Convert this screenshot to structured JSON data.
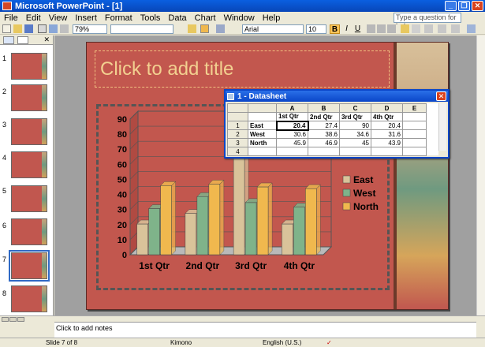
{
  "window": {
    "title": "Microsoft PowerPoint - [1]"
  },
  "menu": [
    "File",
    "Edit",
    "View",
    "Insert",
    "Format",
    "Tools",
    "Data",
    "Chart",
    "Window",
    "Help"
  ],
  "help_box": "Type a question for help",
  "toolbar": {
    "zoom": "79%",
    "font": "Arial",
    "font_size": "10",
    "bold": "B",
    "italic": "I",
    "underline": "U"
  },
  "thumbnails": [
    "1",
    "2",
    "3",
    "4",
    "5",
    "6",
    "7",
    "8"
  ],
  "slide": {
    "title_placeholder": "Click to add title"
  },
  "notes_placeholder": "Click to add notes",
  "statusbar": {
    "slide": "Slide 7 of 8",
    "design": "Kimono",
    "language": "English (U.S.)"
  },
  "datasheet": {
    "title": "1 - Datasheet",
    "col_letters": [
      "A",
      "B",
      "C",
      "D",
      "E"
    ],
    "col_headers": [
      "1st Qtr",
      "2nd Qtr",
      "3rd Qtr",
      "4th Qtr"
    ],
    "rows": [
      {
        "num": "1",
        "label": "East",
        "values": [
          "20.4",
          "27.4",
          "90",
          "20.4"
        ]
      },
      {
        "num": "2",
        "label": "West",
        "values": [
          "30.6",
          "38.6",
          "34.6",
          "31.6"
        ]
      },
      {
        "num": "3",
        "label": "North",
        "values": [
          "45.9",
          "46.9",
          "45",
          "43.9"
        ]
      },
      {
        "num": "4",
        "label": "",
        "values": [
          "",
          "",
          "",
          ""
        ]
      }
    ]
  },
  "colors": {
    "east": "#d9c39a",
    "west": "#7fb38a",
    "north": "#f0b84e",
    "slide_bg": "#c2574e"
  },
  "chart_data": {
    "type": "bar",
    "categories": [
      "1st Qtr",
      "2nd Qtr",
      "3rd Qtr",
      "4th Qtr"
    ],
    "series": [
      {
        "name": "East",
        "values": [
          20.4,
          27.4,
          90,
          20.4
        ]
      },
      {
        "name": "West",
        "values": [
          30.6,
          38.6,
          34.6,
          31.6
        ]
      },
      {
        "name": "North",
        "values": [
          45.9,
          46.9,
          45,
          43.9
        ]
      }
    ],
    "yticks": [
      "0",
      "10",
      "20",
      "30",
      "40",
      "50",
      "60",
      "70",
      "80",
      "90"
    ],
    "ylim": [
      0,
      90
    ],
    "legend": "right",
    "grid": true
  }
}
